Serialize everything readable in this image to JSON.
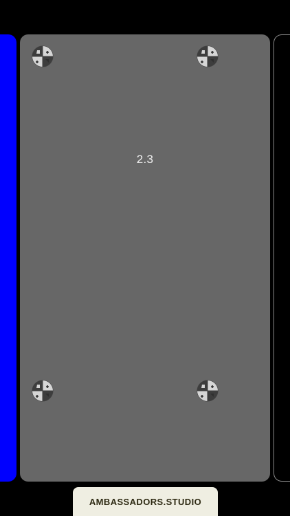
{
  "carousel": {
    "current_card": {
      "label": "2.3",
      "color": "#676767"
    },
    "previous_card": {
      "color": "#0000ff"
    },
    "next_card": {
      "color": "#000000",
      "border_color": "#8a8a8a"
    },
    "markers": {
      "icon": "registration-crosshair-icon",
      "count": 4
    }
  },
  "footer": {
    "brand_label": "AMBASSADORS.STUDIO",
    "background": "#efeee2",
    "text_color": "#2f2b14"
  }
}
